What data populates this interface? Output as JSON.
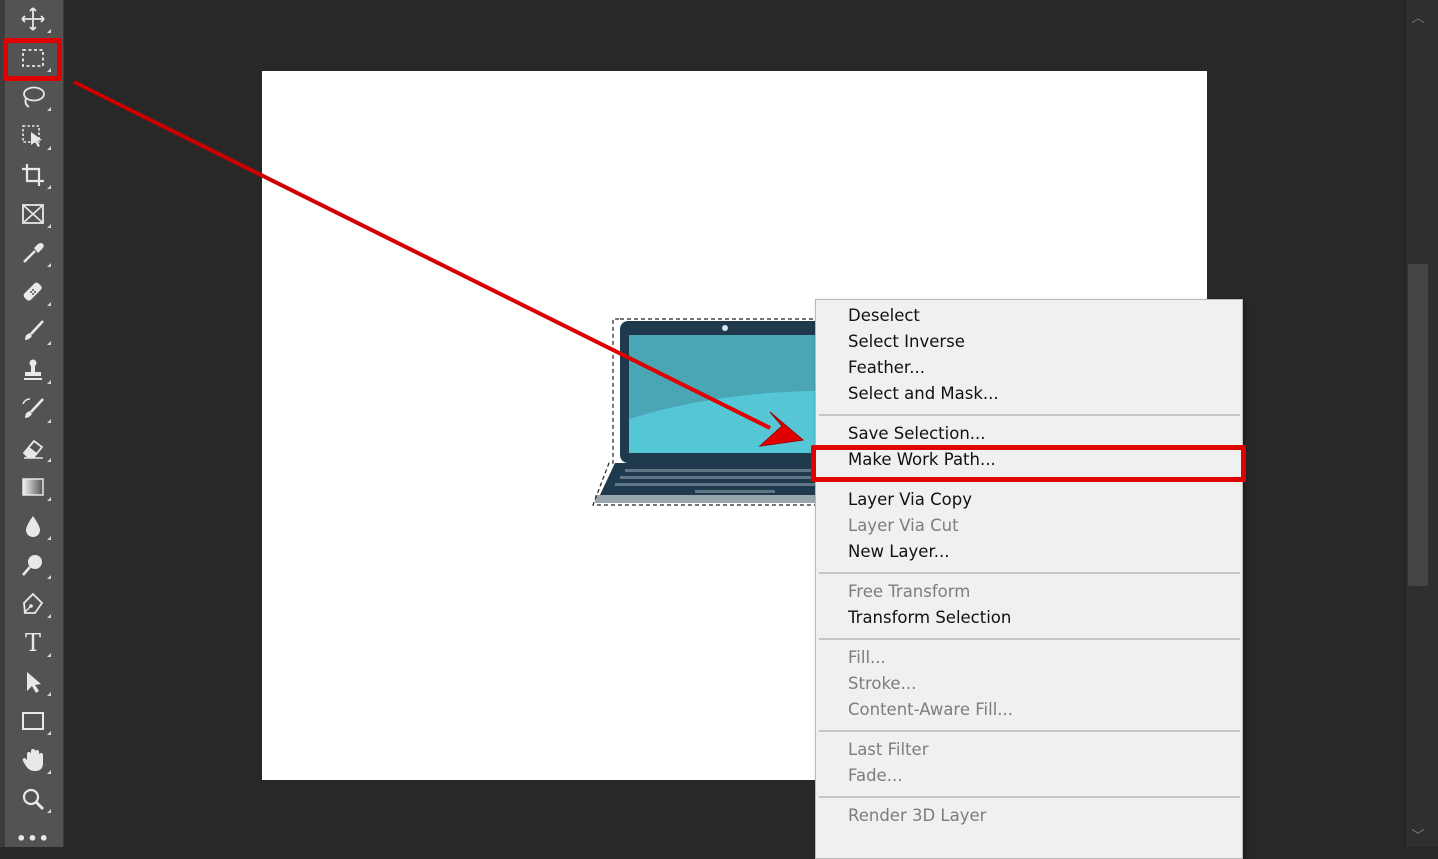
{
  "toolbar": {
    "tools": [
      {
        "name": "move-tool",
        "icon": "move-icon"
      },
      {
        "name": "rectangular-marquee-tool",
        "icon": "marquee-icon",
        "active": true
      },
      {
        "name": "lasso-tool",
        "icon": "lasso-icon"
      },
      {
        "name": "object-selection-tool",
        "icon": "object-selection-icon"
      },
      {
        "name": "crop-tool",
        "icon": "crop-icon"
      },
      {
        "name": "frame-tool",
        "icon": "frame-icon"
      },
      {
        "name": "eyedropper-tool",
        "icon": "eyedropper-icon"
      },
      {
        "name": "healing-brush-tool",
        "icon": "bandage-icon"
      },
      {
        "name": "brush-tool",
        "icon": "brush-icon"
      },
      {
        "name": "clone-stamp-tool",
        "icon": "stamp-icon"
      },
      {
        "name": "history-brush-tool",
        "icon": "history-brush-icon"
      },
      {
        "name": "eraser-tool",
        "icon": "eraser-icon"
      },
      {
        "name": "gradient-tool",
        "icon": "gradient-icon"
      },
      {
        "name": "blur-tool",
        "icon": "drop-icon"
      },
      {
        "name": "dodge-tool",
        "icon": "dodge-icon"
      },
      {
        "name": "pen-tool",
        "icon": "pen-icon"
      },
      {
        "name": "type-tool",
        "icon": "type-icon",
        "glyph": "T"
      },
      {
        "name": "path-selection-tool",
        "icon": "arrow-cursor-icon"
      },
      {
        "name": "rectangle-tool",
        "icon": "rectangle-icon"
      },
      {
        "name": "hand-tool",
        "icon": "hand-icon"
      },
      {
        "name": "zoom-tool",
        "icon": "magnifier-icon"
      },
      {
        "name": "more-tools",
        "icon": "ellipsis-icon",
        "glyph": "•••"
      }
    ]
  },
  "context_menu": {
    "groups": [
      [
        {
          "label": "Deselect",
          "enabled": true
        },
        {
          "label": "Select Inverse",
          "enabled": true
        },
        {
          "label": "Feather...",
          "enabled": true
        },
        {
          "label": "Select and Mask...",
          "enabled": true
        }
      ],
      [
        {
          "label": "Save Selection...",
          "enabled": true
        },
        {
          "label": "Make Work Path...",
          "enabled": true,
          "highlighted": true
        }
      ],
      [
        {
          "label": "Layer Via Copy",
          "enabled": true
        },
        {
          "label": "Layer Via Cut",
          "enabled": false
        },
        {
          "label": "New Layer...",
          "enabled": true
        }
      ],
      [
        {
          "label": "Free Transform",
          "enabled": false
        },
        {
          "label": "Transform Selection",
          "enabled": true
        }
      ],
      [
        {
          "label": "Fill...",
          "enabled": false
        },
        {
          "label": "Stroke...",
          "enabled": false
        },
        {
          "label": "Content-Aware Fill...",
          "enabled": false
        }
      ],
      [
        {
          "label": "Last Filter",
          "enabled": false
        },
        {
          "label": "Fade...",
          "enabled": false
        }
      ],
      [
        {
          "label": "Render 3D Layer",
          "enabled": false
        }
      ]
    ]
  },
  "annotation": {
    "color": "#e00000"
  },
  "colors": {
    "workspace": "#282828",
    "toolbar": "#535353",
    "menu_bg": "#f0f0f0",
    "laptop_body": "#1f3a4d",
    "laptop_screen": "#55c6d6"
  }
}
